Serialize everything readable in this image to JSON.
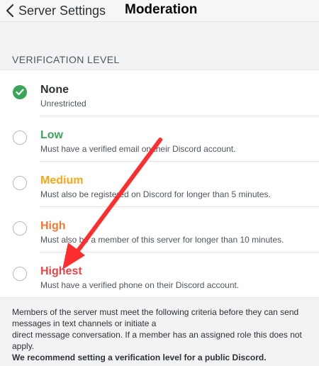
{
  "header": {
    "back_label": "Server Settings",
    "title": "Moderation"
  },
  "section_label": "VERIFICATION LEVEL",
  "options": [
    {
      "name": "None",
      "description": "Unrestricted",
      "color": "#2e3338",
      "selected": true
    },
    {
      "name": "Low",
      "description": "Must have a verified email on their Discord account.",
      "color": "#3ba55d",
      "selected": false
    },
    {
      "name": "Medium",
      "description": "Must also be registered on Discord for longer than 5 minutes.",
      "color": "#faa61a",
      "selected": false
    },
    {
      "name": "High",
      "description": "Must also be a member of this server for longer than 10 minutes.",
      "color": "#f57731",
      "selected": false
    },
    {
      "name": "Highest",
      "description": "Must have a verified phone on their Discord account.",
      "color": "#ed4245",
      "selected": false
    }
  ],
  "footer": {
    "line1": "Members of the server must meet the following criteria before they can send messages in text channels or initiate a",
    "line2": "direct message conversation. If a member has an assigned role this does not apply.",
    "recommendation": "We recommend setting a verification level for a public Discord."
  },
  "colors": {
    "selected": "#3ba55d",
    "annotation_arrow": "#ff2d2d"
  },
  "icons": {
    "back": "chevron-left-icon",
    "selected": "checkmark-icon",
    "annotation": "red-arrow-annotation"
  }
}
